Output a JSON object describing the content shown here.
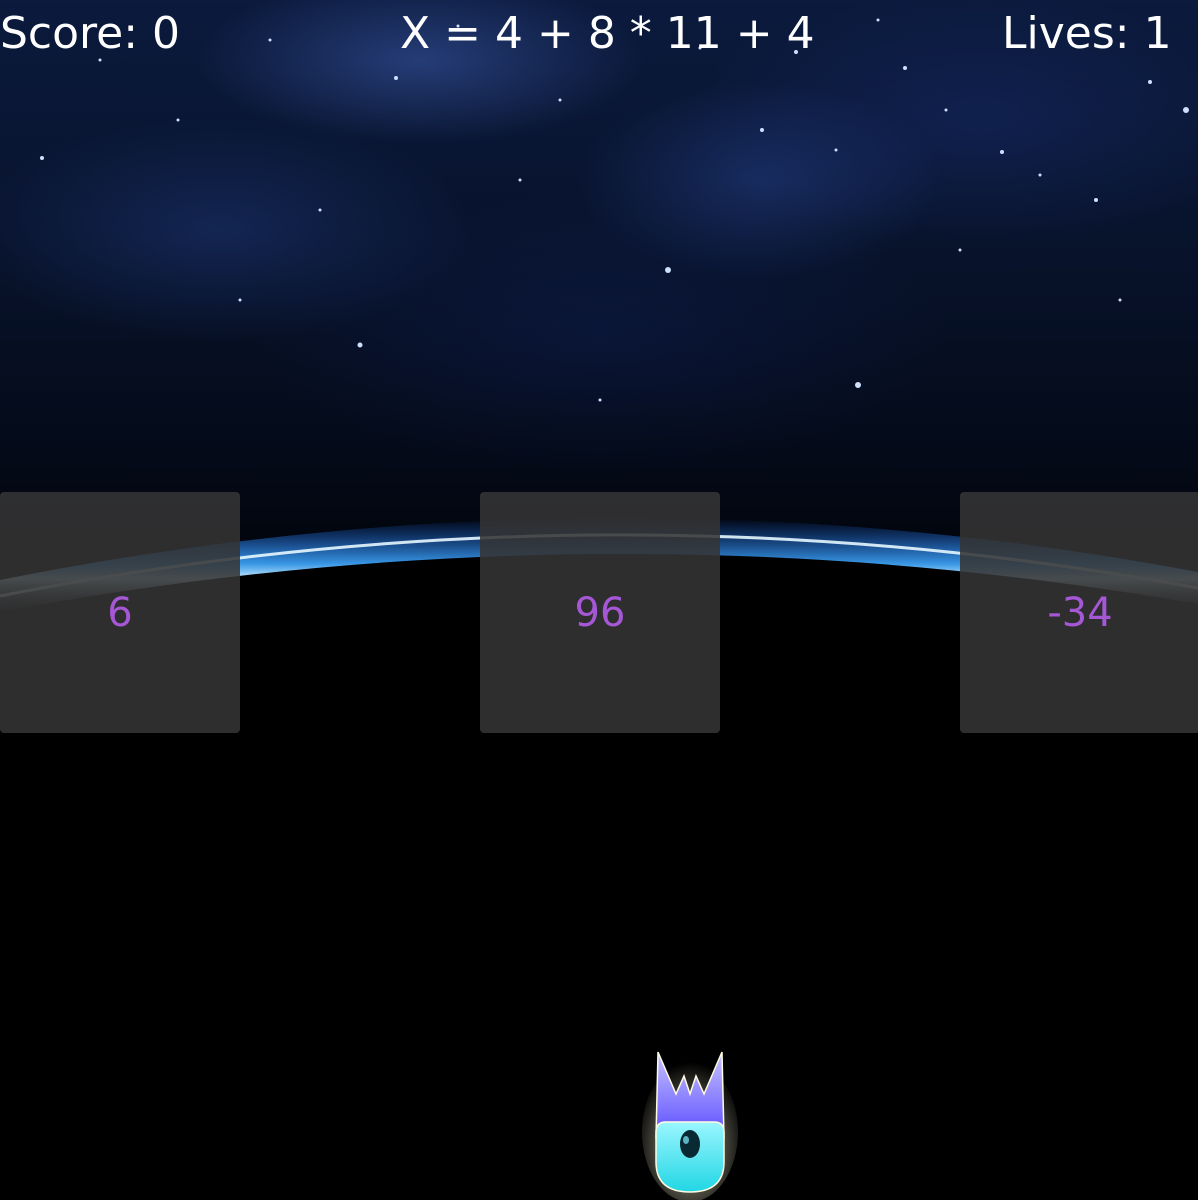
{
  "hud": {
    "score": "Score: 0",
    "equation": "X = 4 + 8 * 11 + 4",
    "lives": "Lives: 1"
  },
  "answers": [
    "6",
    "96",
    "-34"
  ],
  "player": {
    "icon": "spaceship-icon"
  },
  "colors": {
    "answer_text": "#a557d6",
    "answer_box": "#343434",
    "hud_text": "#ffffff",
    "horizon_glow": "#4db8ff",
    "ship_body": "#3ee8f0",
    "ship_fins": "#6a5cff"
  }
}
